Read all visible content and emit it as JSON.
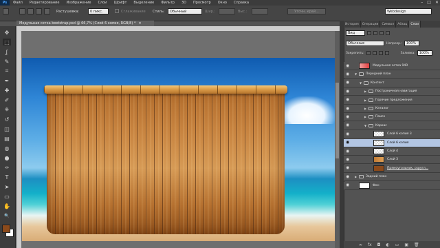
{
  "app": {
    "logo": "Ps"
  },
  "menu": [
    "Файл",
    "Редактирование",
    "Изображение",
    "Слои",
    "Шрифт",
    "Выделение",
    "Фильтр",
    "3D",
    "Просмотр",
    "Окно",
    "Справка"
  ],
  "window_controls": [
    "–",
    "□",
    "✕"
  ],
  "options": {
    "feather_label": "Растушевка:",
    "feather_value": "0 пикс.",
    "antialias_label": "Сглаживание",
    "style_label": "Стиль:",
    "style_value": "Обычный",
    "width_label": "Шир.:",
    "height_label": "Выс.:",
    "refine_label": "Уточн. край...",
    "workspace_value": "Webdesign"
  },
  "document": {
    "tab_title": "Модульная сетка bootstrap.psd @ 66,7% (Слой 6 копия, RGB/8) *",
    "tab_close": "×"
  },
  "panel_tabs": [
    "История",
    "Операции",
    "Символ",
    "Абзац",
    "Слои"
  ],
  "layers_panel": {
    "filter_label": "Вид",
    "blend_mode": "Обычные",
    "opacity_label": "Непрозр.:",
    "opacity_value": "100%",
    "lock_label": "Закрепить:",
    "fill_label": "Заливка:",
    "fill_value": "100%"
  },
  "layers": [
    {
      "name": "Модульная сетка 940",
      "indent": 0,
      "kind": "thumb-red",
      "selected": false,
      "expanded": false
    },
    {
      "name": "Передний план",
      "indent": 0,
      "kind": "folder",
      "selected": false,
      "expanded": true
    },
    {
      "name": "Контент",
      "indent": 1,
      "kind": "folder",
      "selected": false,
      "expanded": true
    },
    {
      "name": "Постраничная навигация",
      "indent": 2,
      "kind": "folder",
      "selected": false,
      "expanded": false
    },
    {
      "name": "Горячие предложения",
      "indent": 2,
      "kind": "folder",
      "selected": false,
      "expanded": false
    },
    {
      "name": "Каталог",
      "indent": 2,
      "kind": "folder",
      "selected": false,
      "expanded": false
    },
    {
      "name": "Поиск",
      "indent": 2,
      "kind": "folder",
      "selected": false,
      "expanded": false
    },
    {
      "name": "Каркас",
      "indent": 2,
      "kind": "folder",
      "selected": false,
      "expanded": true
    },
    {
      "name": "Слой 6 копия 3",
      "indent": 3,
      "kind": "thumb-clear",
      "selected": false,
      "expanded": false
    },
    {
      "name": "Слой 6 копия",
      "indent": 3,
      "kind": "thumb-clear",
      "selected": true,
      "expanded": false
    },
    {
      "name": "Слой 4",
      "indent": 3,
      "kind": "thumb-clear",
      "selected": false,
      "expanded": false
    },
    {
      "name": "Слой 3",
      "indent": 3,
      "kind": "thumb-wood",
      "selected": false,
      "expanded": false
    },
    {
      "name": "Прямоугольник, скругл...",
      "indent": 3,
      "kind": "thumb-brown",
      "selected": false,
      "expanded": false
    },
    {
      "name": "Задний план",
      "indent": 0,
      "kind": "folder",
      "selected": false,
      "expanded": false
    },
    {
      "name": "Фон",
      "indent": 0,
      "kind": "thumb-white",
      "selected": false,
      "expanded": false
    }
  ],
  "panel_footer": [
    "∞",
    "fx",
    "◘",
    "◐",
    "▭",
    "▣",
    "🗑"
  ],
  "tools": [
    "move-tool",
    "marquee-tool",
    "lasso-tool",
    "quick-select-tool",
    "crop-tool",
    "eyedropper-tool",
    "heal-tool",
    "brush-tool",
    "stamp-tool",
    "history-brush-tool",
    "eraser-tool",
    "gradient-tool",
    "blur-tool",
    "dodge-tool",
    "pen-tool",
    "type-tool",
    "path-select-tool",
    "shape-tool",
    "hand-tool",
    "zoom-tool"
  ],
  "tool_glyphs": [
    "✥",
    "⬚",
    "ʆ",
    "✎",
    "⌗",
    "✒",
    "✚",
    "✐",
    "⎈",
    "↺",
    "◫",
    "▤",
    "◍",
    "●",
    "✑",
    "T",
    "➤",
    "▭",
    "✋",
    "🔍"
  ],
  "colors": {
    "foreground": "#8b4a1b",
    "background": "#ffffff",
    "selection": "#b3c6e3"
  }
}
